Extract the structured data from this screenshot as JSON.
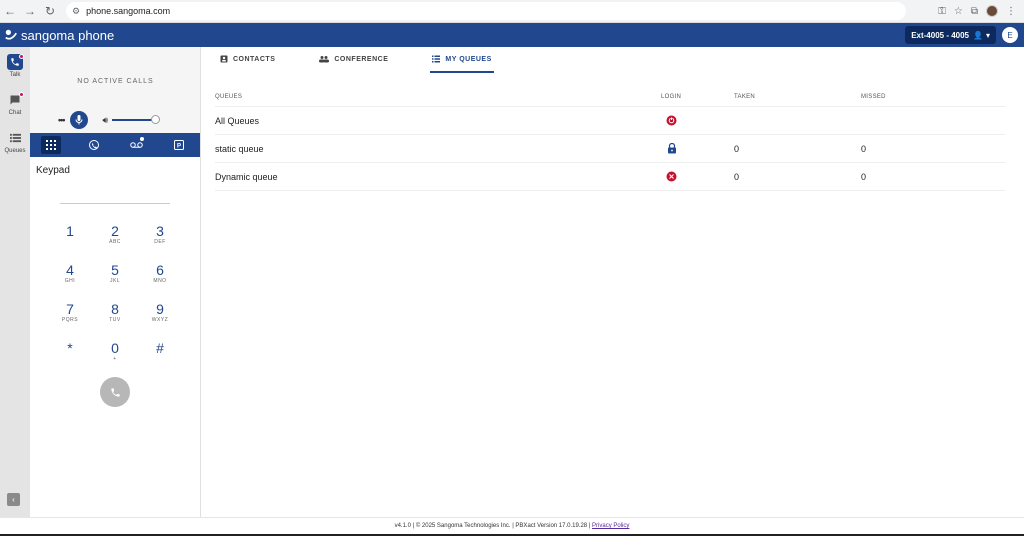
{
  "browser": {
    "url": "phone.sangoma.com",
    "back_icon": "arrow-left-icon",
    "forward_icon": "arrow-right-icon",
    "reload_icon": "reload-icon"
  },
  "header": {
    "logo_text": "sangoma phone",
    "extension": "Ext-4005 - 4005",
    "avatar_initial": "E"
  },
  "rail": {
    "items": [
      {
        "label": "Talk",
        "icon": "phone-icon",
        "active": true,
        "badge": true
      },
      {
        "label": "Chat",
        "icon": "chat-icon",
        "active": false,
        "badge": true
      },
      {
        "label": "Queues",
        "icon": "queues-icon",
        "active": false,
        "badge": false
      }
    ]
  },
  "phone": {
    "no_active_calls": "NO ACTIVE CALLS",
    "more_label": "•••",
    "volume_level": 0.85,
    "keypad_title": "Keypad",
    "keys": [
      [
        {
          "d": "1",
          "l": ""
        },
        {
          "d": "2",
          "l": "ABC"
        },
        {
          "d": "3",
          "l": "DEF"
        }
      ],
      [
        {
          "d": "4",
          "l": "GHI"
        },
        {
          "d": "5",
          "l": "JKL"
        },
        {
          "d": "6",
          "l": "MNO"
        }
      ],
      [
        {
          "d": "7",
          "l": "PQRS"
        },
        {
          "d": "8",
          "l": "TUV"
        },
        {
          "d": "9",
          "l": "WXYZ"
        }
      ],
      [
        {
          "d": "*",
          "l": ""
        },
        {
          "d": "0",
          "l": "+"
        },
        {
          "d": "#",
          "l": ""
        }
      ]
    ]
  },
  "tabs": {
    "contacts": "CONTACTS",
    "conference": "CONFERENCE",
    "my_queues": "MY QUEUES"
  },
  "queues": {
    "headers": {
      "name": "QUEUES",
      "login": "LOGIN",
      "taken": "TAKEN",
      "missed": "MISSED"
    },
    "rows": [
      {
        "name": "All Queues",
        "login_icon": "logout-icon",
        "taken": "",
        "missed": ""
      },
      {
        "name": "static queue",
        "login_icon": "lock-icon",
        "taken": "0",
        "missed": "0"
      },
      {
        "name": "Dynamic queue",
        "login_icon": "close-circle-icon",
        "taken": "0",
        "missed": "0"
      }
    ]
  },
  "footer": {
    "text": "v4.1.0 | © 2025 Sangoma Technologies Inc. | PBXact Version 17.0.19.28 | ",
    "privacy": "Privacy Policy"
  },
  "colors": {
    "brand": "#21488e",
    "brand_dark": "#0d2a5e",
    "error": "#c8102e",
    "badge": "#c5156a"
  }
}
